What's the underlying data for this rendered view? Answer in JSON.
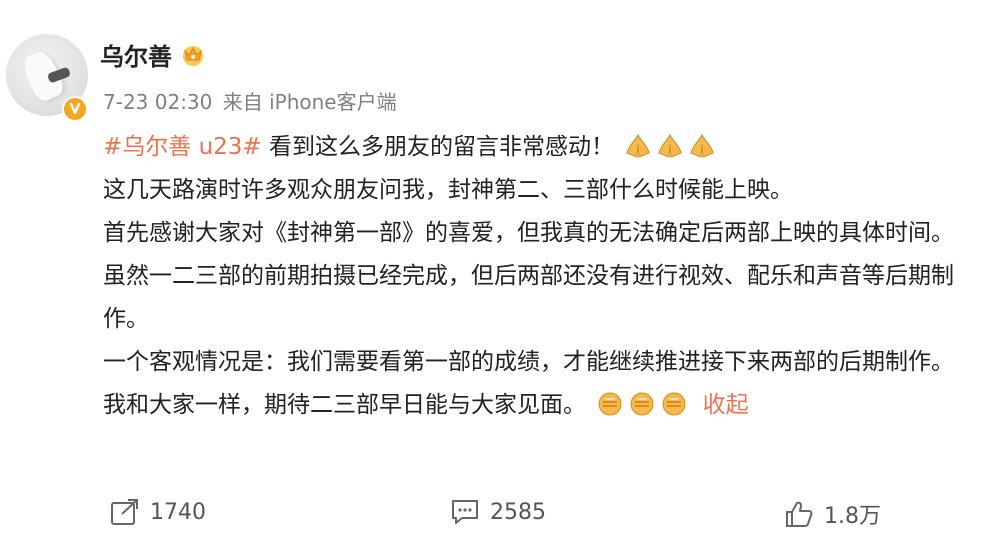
{
  "user": {
    "name": "乌尔善"
  },
  "post": {
    "date": "7-23 02:30",
    "source": "来自 iPhone客户端",
    "hashtag": "#乌尔善 u23#",
    "lines": [
      "看到这么多朋友的留言非常感动！",
      "这几天路演时许多观众朋友问我，封神第二、三部什么时候能上映。",
      "首先感谢大家对《封神第一部》的喜爱，但我真的无法确定后两部上映的具体时间。",
      "虽然一二三部的前期拍摄已经完成，但后两部还没有进行视效、配乐和声音等后期制作。",
      "一个客观情况是：我们需要看第一部的成绩，才能继续推进接下来两部的后期制作。",
      "我和大家一样，期待二三部早日能与大家见面。"
    ],
    "collapse_label": "收起",
    "icons": {
      "first_line_emoji": "folded-hands-icon",
      "last_line_emoji": "fist-icon"
    }
  },
  "actions": {
    "forward": {
      "icon": "forward-icon",
      "count": "1740"
    },
    "comment": {
      "icon": "comment-icon",
      "count": "2585"
    },
    "like": {
      "icon": "like-icon",
      "count": "1.8万"
    }
  },
  "colors": {
    "accent": "#eb7350",
    "verified": "#f5a623",
    "meta": "#808080"
  }
}
